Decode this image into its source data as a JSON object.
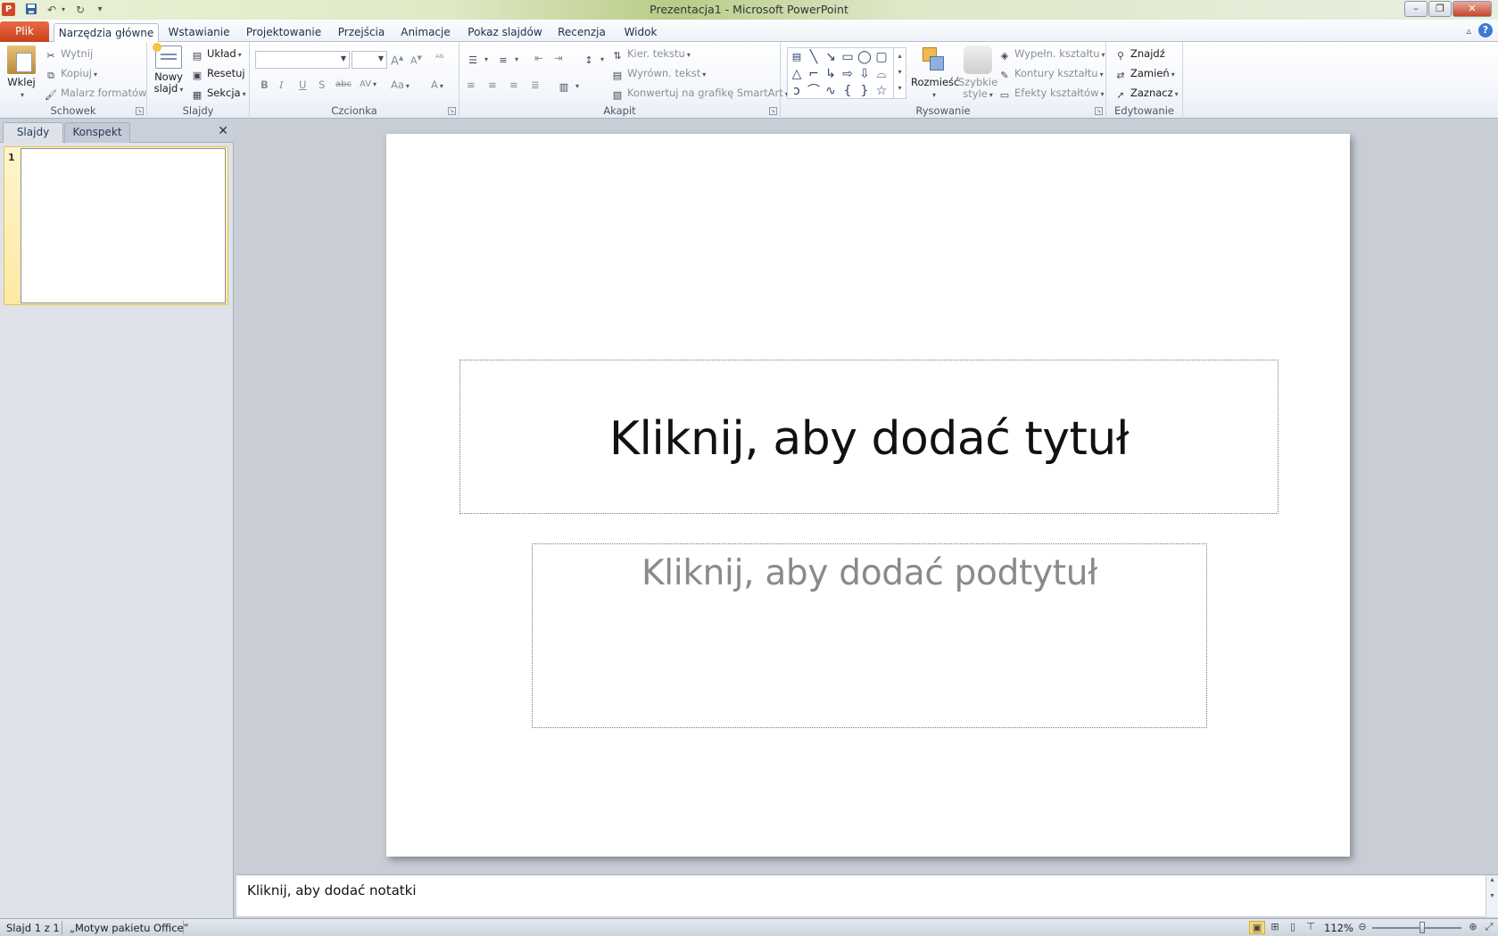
{
  "window": {
    "title": "Prezentacja1  -  Microsoft PowerPoint",
    "app_icon_letter": "P"
  },
  "quick_access": [
    "save-icon",
    "undo-icon",
    "redo-icon",
    "customize-icon"
  ],
  "tabs": [
    {
      "id": "file",
      "label": "Plik"
    },
    {
      "id": "home",
      "label": "Narzędzia główne"
    },
    {
      "id": "insert",
      "label": "Wstawianie"
    },
    {
      "id": "design",
      "label": "Projektowanie"
    },
    {
      "id": "transitions",
      "label": "Przejścia"
    },
    {
      "id": "animations",
      "label": "Animacje"
    },
    {
      "id": "slideshow",
      "label": "Pokaz slajdów"
    },
    {
      "id": "review",
      "label": "Recenzja"
    },
    {
      "id": "view",
      "label": "Widok"
    }
  ],
  "ribbon": {
    "clipboard": {
      "label": "Schowek",
      "paste": "Wklej",
      "cut": "Wytnij",
      "copy": "Kopiuj",
      "format_painter": "Malarz formatów"
    },
    "slides": {
      "label": "Slajdy",
      "new_slide_line1": "Nowy",
      "new_slide_line2": "slajd",
      "layout": "Układ",
      "reset": "Resetuj",
      "section": "Sekcja"
    },
    "font": {
      "label": "Czcionka",
      "font_name": "",
      "font_size": ""
    },
    "paragraph": {
      "label": "Akapit",
      "text_direction": "Kier. tekstu",
      "align_text": "Wyrówn. tekst",
      "smartart": "Konwertuj na grafikę SmartArt"
    },
    "drawing": {
      "label": "Rysowanie",
      "arrange": "Rozmieść",
      "quick_styles_line1": "Szybkie",
      "quick_styles_line2": "style",
      "shape_fill": "Wypełn. kształtu",
      "shape_outline": "Kontury kształtu",
      "shape_effects": "Efekty kształtów"
    },
    "editing": {
      "label": "Edytowanie",
      "find": "Znajdź",
      "replace": "Zamień",
      "select": "Zaznacz"
    }
  },
  "left_pane": {
    "tab_slides": "Slajdy",
    "tab_outline": "Konspekt",
    "slide_number": "1"
  },
  "slide": {
    "title_placeholder": "Kliknij, aby dodać tytuł",
    "subtitle_placeholder": "Kliknij, aby dodać podtytuł"
  },
  "notes": {
    "placeholder": "Kliknij, aby dodać notatki"
  },
  "status": {
    "slide_info": "Slajd 1 z 1",
    "theme": "„Motyw pakietu Office”",
    "zoom": "112%",
    "zoom_fraction": 0.56
  },
  "colors": {
    "file_tab": "#d24726",
    "accent_blue": "#25436e",
    "thumb_selected": "#fde9a4"
  }
}
